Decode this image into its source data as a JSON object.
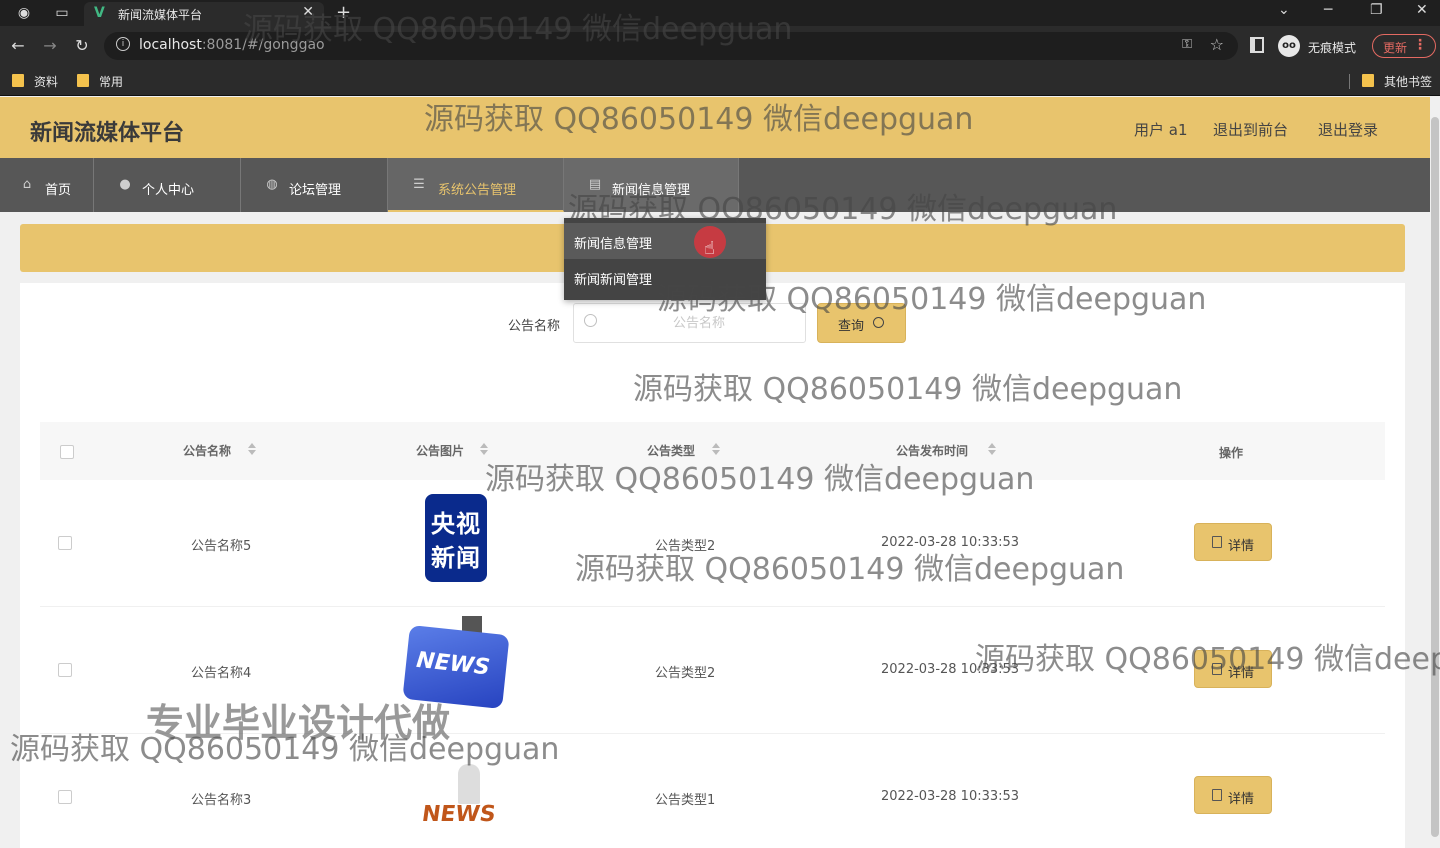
{
  "browser": {
    "tab_title": "新闻流媒体平台",
    "url_host": "localhost",
    "url_rest": ":8081/#/gonggao",
    "incognito_label": "无痕模式",
    "update_label": "更新",
    "bookmarks": [
      "资料",
      "常用"
    ],
    "other_bookmarks": "其他书签"
  },
  "header": {
    "title": "新闻流媒体平台",
    "user": "用户 a1",
    "back_to_front": "退出到前台",
    "logout": "退出登录"
  },
  "nav": {
    "items": [
      {
        "label": "首页",
        "icon": "home-icon"
      },
      {
        "label": "个人中心",
        "icon": "user-icon"
      },
      {
        "label": "论坛管理",
        "icon": "lightbulb-icon"
      },
      {
        "label": "系统公告管理",
        "icon": "list-icon"
      },
      {
        "label": "新闻信息管理",
        "icon": "document-icon"
      }
    ],
    "active_index": 3
  },
  "dropdown": {
    "items": [
      "新闻信息管理",
      "新闻新闻管理"
    ]
  },
  "search": {
    "label": "公告名称",
    "placeholder": "公告名称",
    "button": "查询"
  },
  "table": {
    "headers": [
      "公告名称",
      "公告图片",
      "公告类型",
      "公告发布时间",
      "操作"
    ],
    "rows": [
      {
        "name": "公告名称5",
        "type": "公告类型2",
        "time": "2022-03-28 10:33:53",
        "action": "详情",
        "image": "央视 新闻"
      },
      {
        "name": "公告名称4",
        "type": "公告类型2",
        "time": "2022-03-28 10:33:53",
        "action": "详情",
        "image": "NEWS"
      },
      {
        "name": "公告名称3",
        "type": "公告类型1",
        "time": "2022-03-28 10:33:53",
        "action": "详情",
        "image": "NEWS"
      }
    ]
  },
  "watermarks": {
    "text": "源码获取 QQ86050149 微信deepguan",
    "text_cut": "源码获取 QQ86050149 微信deep",
    "big": "专业毕业设计代做"
  },
  "colors": {
    "accent": "#e8c46d",
    "nav_bg": "#575757",
    "dropdown_bg": "#444444"
  }
}
